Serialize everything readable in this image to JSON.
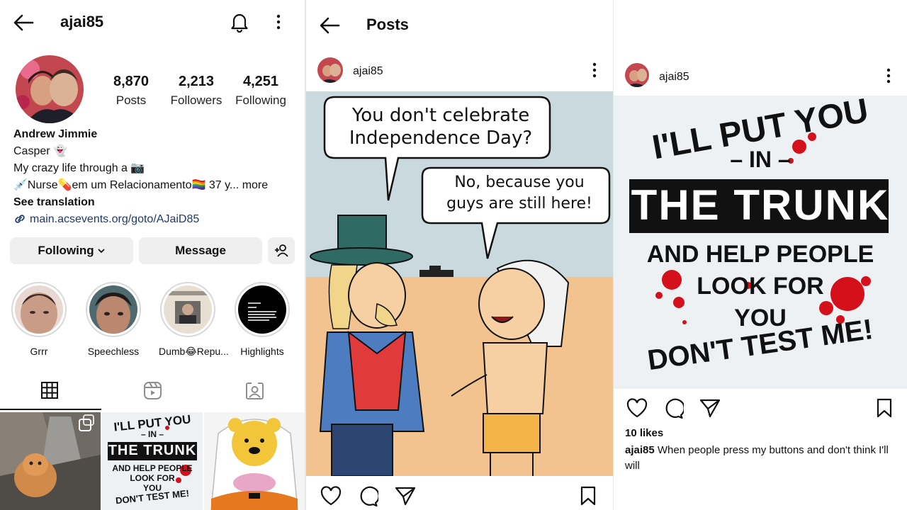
{
  "profile": {
    "username": "ajai85",
    "stats": [
      {
        "value": "8,870",
        "label": "Posts"
      },
      {
        "value": "2,213",
        "label": "Followers"
      },
      {
        "value": "4,251",
        "label": "Following"
      }
    ],
    "name": "Andrew Jimmie",
    "bio": [
      "Casper 👻",
      "My crazy life through a 📷",
      "💉Nurse💊em um Relacionamento🏳️‍🌈 37 y... more"
    ],
    "see_translation": "See translation",
    "link": "main.acsevents.org/goto/AJaiD85",
    "buttons": {
      "following": "Following",
      "message": "Message"
    },
    "highlights": [
      "Grrr",
      "Speechless",
      "Dumb😂Repu...",
      "Highlights"
    ]
  },
  "posts_view": {
    "title": "Posts",
    "post1": {
      "username": "ajai85",
      "bubble1": [
        "You don't celebrate",
        "Independence Day?"
      ],
      "bubble2": [
        "No, because you",
        "guys are still here!"
      ]
    },
    "post2": {
      "username": "ajai85",
      "lines": [
        "I'LL PUT YOU",
        "– IN –",
        "THE TRUNK",
        "AND HELP PEOPLE",
        "LOOK FOR",
        "YOU",
        "DON'T TEST ME!"
      ],
      "likes": "10 likes",
      "caption_user": "ajai85",
      "caption_text": "When people press my buttons and don't think I'll will"
    }
  },
  "grid_thumb": {
    "lines": [
      "I'LL PUT YOU",
      "– IN –",
      "THE TRUNK",
      "AND HELP PEOPLE",
      "LOOK FOR",
      "YOU",
      "DON'T TEST ME!"
    ]
  },
  "colors": {
    "accent": "#0095f6",
    "text": "#111111",
    "button_bg": "#efefef",
    "red_splatter": "#d4101a"
  }
}
